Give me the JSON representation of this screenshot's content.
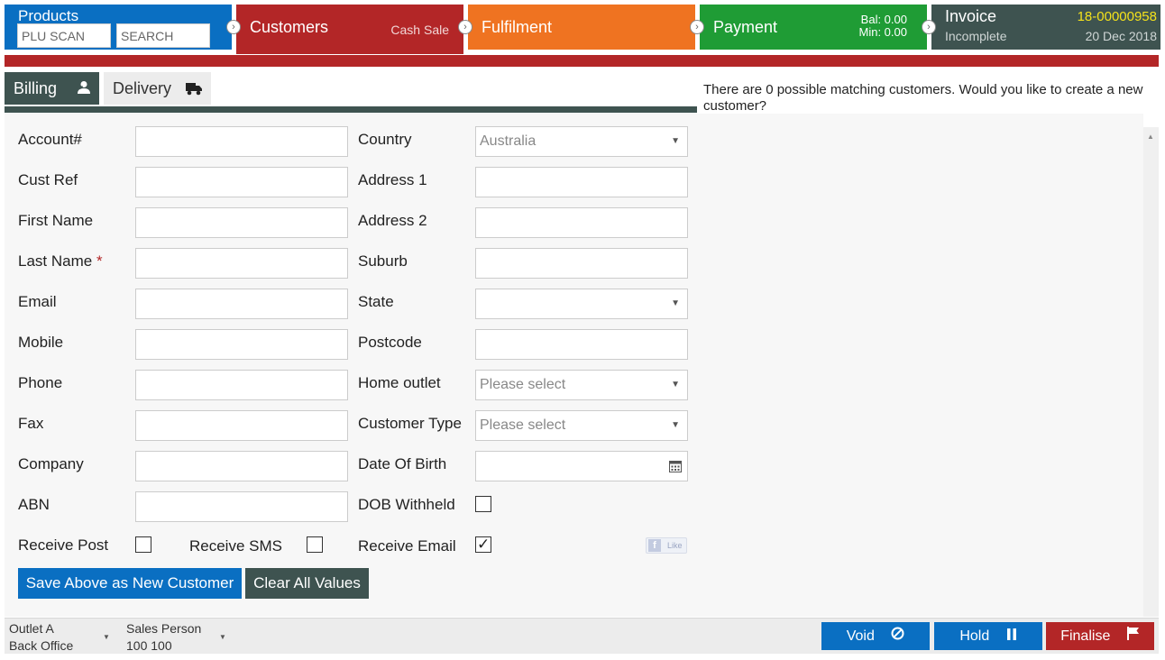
{
  "steps": {
    "products": {
      "title": "Products",
      "plu_placeholder": "PLU SCAN",
      "search_placeholder": "SEARCH"
    },
    "customers": {
      "title": "Customers",
      "sub": "Cash Sale"
    },
    "fulfilment": {
      "title": "Fulfilment"
    },
    "payment": {
      "title": "Payment",
      "bal": "Bal:  0.00",
      "min": "Min:  0.00"
    },
    "invoice": {
      "title": "Invoice",
      "number": "18-00000958",
      "status": "Incomplete",
      "date": "20 Dec 2018"
    }
  },
  "tabs": {
    "billing": "Billing",
    "delivery": "Delivery"
  },
  "match_message": "There are 0 possible matching customers. Would you like to create a new customer?",
  "form": {
    "left": [
      {
        "label": "Account#"
      },
      {
        "label": "Cust Ref"
      },
      {
        "label": "First Name"
      },
      {
        "label": "Last Name"
      },
      {
        "label": "Email"
      },
      {
        "label": "Mobile"
      },
      {
        "label": "Phone"
      },
      {
        "label": "Fax"
      },
      {
        "label": "Company"
      },
      {
        "label": "ABN"
      }
    ],
    "required_mark": "*",
    "right": {
      "country_label": "Country",
      "country_value": "Australia",
      "address1_label": "Address 1",
      "address2_label": "Address 2",
      "suburb_label": "Suburb",
      "state_label": "State",
      "state_value": "",
      "postcode_label": "Postcode",
      "home_outlet_label": "Home outlet",
      "home_outlet_value": "Please select",
      "customer_type_label": "Customer Type",
      "customer_type_value": "Please select",
      "dob_label": "Date Of Birth",
      "dob_withheld_label": "DOB Withheld"
    },
    "receive_post_label": "Receive Post",
    "receive_sms_label": "Receive SMS",
    "receive_email_label": "Receive Email",
    "receive_post": false,
    "receive_sms": false,
    "receive_email": true,
    "dob_withheld": false,
    "fb_like": "Like"
  },
  "buttons": {
    "save": "Save Above as New Customer",
    "clear": "Clear All Values"
  },
  "footer": {
    "outlet": "Outlet A",
    "outlet_sub": "Back Office",
    "sales_person": "Sales Person",
    "sales_person_value": "100 100",
    "void": "Void",
    "hold": "Hold",
    "finalise": "Finalise"
  },
  "icons": [
    "person-icon",
    "truck-icon",
    "chevron-right-icon",
    "calendar-icon",
    "ban-icon",
    "pause-icon",
    "flag-icon",
    "facebook-icon"
  ],
  "colors": {
    "blue": "#0a6fc2",
    "red": "#b32627",
    "orange": "#ef7321",
    "green": "#1f9c35",
    "slate": "#3e5350",
    "invoice_number": "#f4e21b"
  }
}
